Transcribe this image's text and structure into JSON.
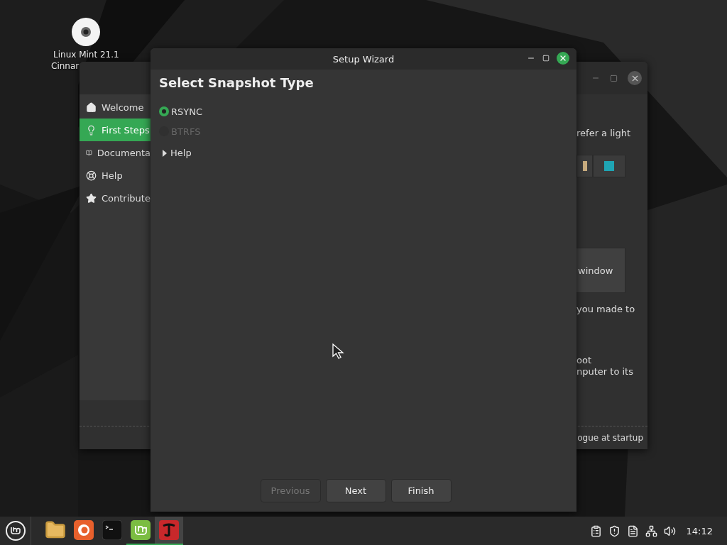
{
  "desktop_icon": {
    "lines": [
      "Linux Mint 21.1",
      "Cinnar"
    ]
  },
  "background_window": {
    "sidebar": [
      {
        "kind": "home",
        "label": "Welcome",
        "selected": false
      },
      {
        "kind": "bulb",
        "label": "First Steps",
        "selected": true
      },
      {
        "kind": "book",
        "label": "Documenta",
        "selected": false
      },
      {
        "kind": "help",
        "label": "Help",
        "selected": false
      },
      {
        "kind": "star",
        "label": "Contribute",
        "selected": false
      }
    ],
    "fragments": [
      {
        "kind": "text",
        "text": "refer a light"
      },
      {
        "kind": "swatches",
        "swatches": [
          {
            "color": "#c9ad7f"
          },
          {
            "color": "#1fa4b3"
          }
        ]
      },
      {
        "kind": "button",
        "text": "window"
      },
      {
        "kind": "text",
        "text": "you made to"
      },
      {
        "kind": "text",
        "text": "oot"
      },
      {
        "kind": "text",
        "text": "nputer to its"
      }
    ],
    "footer": "ogue at startup"
  },
  "wizard": {
    "title": "Setup Wizard",
    "heading": "Select Snapshot Type",
    "options": [
      {
        "label": "RSYNC",
        "selected": true,
        "disabled": false
      },
      {
        "label": "BTRFS",
        "selected": false,
        "disabled": true
      }
    ],
    "expander": {
      "label": "Help",
      "expanded": false
    },
    "buttons": [
      {
        "label": "Previous",
        "disabled": true
      },
      {
        "label": "Next",
        "disabled": false
      },
      {
        "label": "Finish",
        "disabled": false
      }
    ]
  },
  "taskbar": {
    "launchers": [
      {
        "kind": "files",
        "active": false
      },
      {
        "kind": "browser",
        "active": false
      },
      {
        "kind": "terminal",
        "active": false
      },
      {
        "kind": "mint",
        "active": true
      },
      {
        "kind": "app",
        "active": true
      }
    ],
    "clock": "14:12"
  }
}
